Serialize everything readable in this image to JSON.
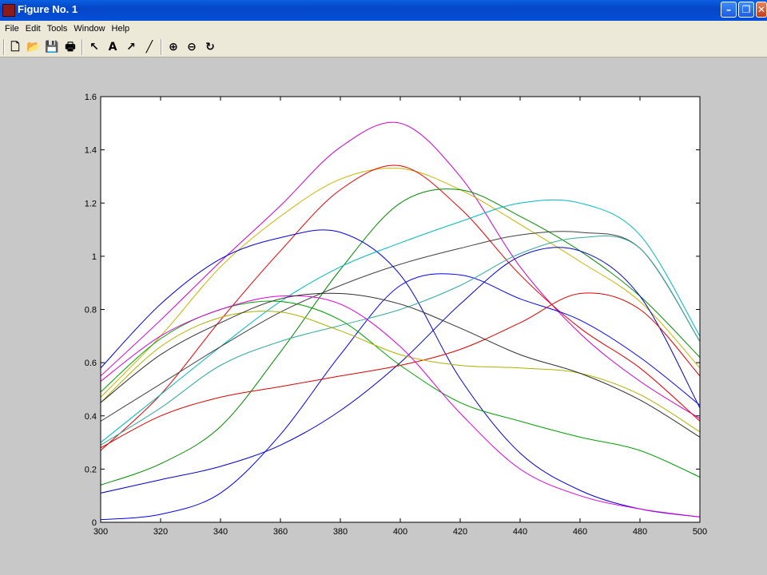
{
  "window": {
    "title": "Figure No. 1"
  },
  "menu": [
    "File",
    "Edit",
    "Tools",
    "Window",
    "Help"
  ],
  "toolbar": {
    "tools": [
      {
        "name": "new-figure-icon",
        "glyph": "🗋"
      },
      {
        "name": "open-file-icon",
        "glyph": "📂"
      },
      {
        "name": "save-icon",
        "glyph": "💾"
      },
      {
        "name": "print-icon",
        "glyph": "🖶"
      },
      {
        "name": "select-arrow-icon",
        "glyph": "↖"
      },
      {
        "name": "insert-text-icon",
        "glyph": "A"
      },
      {
        "name": "insert-arrow-icon",
        "glyph": "↗"
      },
      {
        "name": "insert-line-icon",
        "glyph": "╱"
      },
      {
        "name": "zoom-in-icon",
        "glyph": "⊕"
      },
      {
        "name": "zoom-out-icon",
        "glyph": "⊖"
      },
      {
        "name": "rotate-icon",
        "glyph": "↻"
      }
    ]
  },
  "chart_data": {
    "type": "line",
    "title": "",
    "xlabel": "",
    "ylabel": "",
    "xlim": [
      300,
      500
    ],
    "ylim": [
      0,
      1.6
    ],
    "xticks": [
      "300",
      "320",
      "340",
      "360",
      "380",
      "400",
      "420",
      "440",
      "460",
      "480",
      "500"
    ],
    "yticks": [
      "0",
      "0.2",
      "0.4",
      "0.6",
      "0.8",
      "1",
      "1.2",
      "1.4",
      "1.6"
    ],
    "x": [
      300,
      320,
      340,
      360,
      380,
      400,
      420,
      440,
      460,
      480,
      500
    ],
    "series": [
      {
        "color": "#cc00cc",
        "values": [
          0.55,
          0.76,
          0.98,
          1.19,
          1.41,
          1.5,
          1.3,
          0.96,
          0.71,
          0.53,
          0.39
        ]
      },
      {
        "color": "#c8b400",
        "values": [
          0.47,
          0.7,
          0.96,
          1.15,
          1.29,
          1.33,
          1.25,
          1.12,
          0.98,
          0.83,
          0.58
        ]
      },
      {
        "color": "#e60000",
        "values": [
          0.27,
          0.48,
          0.76,
          1.02,
          1.25,
          1.34,
          1.18,
          0.93,
          0.73,
          0.58,
          0.38
        ]
      },
      {
        "color": "#008800",
        "values": [
          0.14,
          0.22,
          0.36,
          0.64,
          0.95,
          1.2,
          1.25,
          1.15,
          1.02,
          0.85,
          0.62
        ]
      },
      {
        "color": "#0000dd",
        "values": [
          0.58,
          0.82,
          0.99,
          1.07,
          1.09,
          0.93,
          0.54,
          0.26,
          0.12,
          0.05,
          0.02
        ]
      },
      {
        "color": "#00b8c0",
        "values": [
          0.3,
          0.48,
          0.66,
          0.83,
          0.96,
          1.05,
          1.13,
          1.2,
          1.2,
          1.08,
          0.7
        ]
      },
      {
        "color": "#404040",
        "values": [
          0.38,
          0.52,
          0.66,
          0.79,
          0.89,
          0.97,
          1.03,
          1.08,
          1.09,
          1.03,
          0.68
        ]
      },
      {
        "color": "#0000cc",
        "values": [
          0.11,
          0.16,
          0.21,
          0.29,
          0.42,
          0.6,
          0.82,
          1.0,
          1.02,
          0.85,
          0.43
        ]
      },
      {
        "color": "#0000ff",
        "values": [
          0.01,
          0.03,
          0.11,
          0.33,
          0.63,
          0.89,
          0.93,
          0.84,
          0.76,
          0.62,
          0.44
        ]
      },
      {
        "color": "#dd0000",
        "values": [
          0.28,
          0.4,
          0.47,
          0.51,
          0.55,
          0.59,
          0.65,
          0.75,
          0.86,
          0.8,
          0.55
        ]
      },
      {
        "color": "#33aa99",
        "values": [
          0.29,
          0.43,
          0.59,
          0.68,
          0.74,
          0.8,
          0.89,
          1.01,
          1.07,
          1.03,
          0.68
        ]
      },
      {
        "color": "#00a000",
        "values": [
          0.49,
          0.69,
          0.8,
          0.83,
          0.76,
          0.59,
          0.45,
          0.38,
          0.32,
          0.27,
          0.17
        ]
      },
      {
        "color": "#b0b000",
        "values": [
          0.45,
          0.66,
          0.77,
          0.79,
          0.72,
          0.63,
          0.59,
          0.58,
          0.56,
          0.48,
          0.34
        ]
      },
      {
        "color": "#dd00dd",
        "values": [
          0.53,
          0.7,
          0.8,
          0.85,
          0.82,
          0.66,
          0.41,
          0.2,
          0.1,
          0.05,
          0.02
        ]
      },
      {
        "color": "#303030",
        "values": [
          0.45,
          0.63,
          0.75,
          0.84,
          0.86,
          0.82,
          0.73,
          0.63,
          0.56,
          0.46,
          0.32
        ]
      }
    ],
    "grid": false,
    "legend": "none"
  }
}
